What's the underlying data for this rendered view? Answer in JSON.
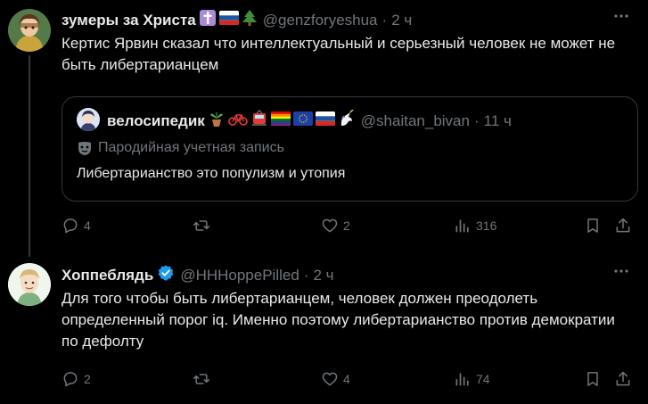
{
  "post1": {
    "name": "зумеры за Христа",
    "handle": "@genzforyeshua",
    "time": "2 ч",
    "text": "Кертис Ярвин сказал что интеллектуальный и серьезный человек не может не быть либертарианцем",
    "quote": {
      "name": "велосипедик",
      "handle": "@shaitan_bivan",
      "time": "11 ч",
      "parody_label": "Пародийная учетная запись",
      "text": "Либертарианство это популизм и утопия"
    },
    "stats": {
      "replies": "4",
      "reposts": "",
      "likes": "2",
      "views": "316"
    }
  },
  "post2": {
    "name": "Хоппеблядь",
    "handle": "@HHHoppePilled",
    "time": "2 ч",
    "text": "Для того чтобы быть либертарианцем, человек должен преодолеть определенный порог iq. Именно поэтому либертарианство против демократии по дефолту",
    "stats": {
      "replies": "2",
      "reposts": "",
      "likes": "4",
      "views": "74"
    }
  },
  "colors": {
    "background": "#000000",
    "text": "#e7e9ea",
    "secondary": "#71767b",
    "border": "#333639",
    "verified": "#1d9bf0"
  },
  "icons": [
    "reply-icon",
    "repost-icon",
    "like-icon",
    "views-icon",
    "bookmark-icon",
    "share-icon",
    "more-icon",
    "verified-icon",
    "mask-icon"
  ]
}
